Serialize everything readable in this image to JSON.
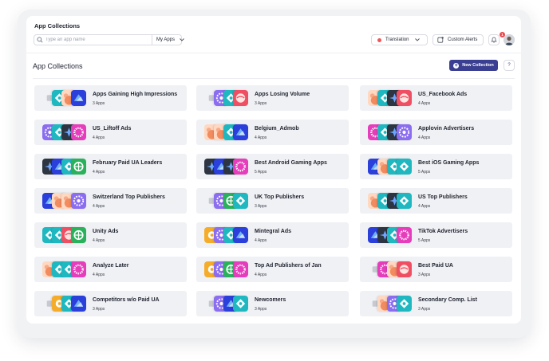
{
  "header": {
    "app_title": "App Collections",
    "search": {
      "placeholder": "Type an app name",
      "value": ""
    },
    "filter": {
      "selected": "My Apps"
    },
    "translation_label": "Translation",
    "custom_alerts_label": "Custom Alerts",
    "notification_count": "1"
  },
  "main": {
    "title": "App Collections",
    "new_collection_label": "New Collection",
    "help_label": "?"
  },
  "palette": {
    "A": [
      "#ffd8c2",
      "#f28c5f"
    ],
    "B": [
      "#2b3fdb",
      "#6fb3ff"
    ],
    "C": [
      "#20b8c0",
      "#ffffff"
    ],
    "D": [
      "#8b6df0",
      "#ffffff"
    ],
    "E": [
      "#ef4f63",
      "#ffe4e0"
    ],
    "F": [
      "#29b25b",
      "#ffffff"
    ],
    "G": [
      "#e53dbb",
      "#ffffff"
    ],
    "H": [
      "#2d3542",
      "#6fa8ff"
    ],
    "I": [
      "#f5ac2a",
      "#ffffff"
    ],
    "J": [
      "#f0f1f4",
      "#c7c9d1"
    ]
  },
  "collections": [
    {
      "name": "Apps Gaining High Impressions",
      "count": "3 Apps",
      "icons": [
        "J",
        "C",
        "A",
        "B"
      ]
    },
    {
      "name": "Apps Losing Volume",
      "count": "3 Apps",
      "icons": [
        "J",
        "D",
        "C",
        "E"
      ]
    },
    {
      "name": "US_Facebook Ads",
      "count": "4 Apps",
      "icons": [
        "A",
        "C",
        "H",
        "E"
      ]
    },
    {
      "name": "US_Liftoff Ads",
      "count": "4 Apps",
      "icons": [
        "D",
        "C",
        "H",
        "G"
      ]
    },
    {
      "name": "Belgium_Admob",
      "count": "4 Apps",
      "icons": [
        "A",
        "A",
        "C",
        "B"
      ]
    },
    {
      "name": "Applovin Advertisers",
      "count": "4 Apps",
      "icons": [
        "G",
        "C",
        "H",
        "D"
      ]
    },
    {
      "name": "February Paid UA Leaders",
      "count": "4 Apps",
      "icons": [
        "H",
        "B",
        "C",
        "F"
      ]
    },
    {
      "name": "Best Android Gaming Apps",
      "count": "5 Apps",
      "icons": [
        "H",
        "B",
        "H",
        "G"
      ]
    },
    {
      "name": "Best iOS Gaming Apps",
      "count": "5 Apps",
      "icons": [
        "B",
        "A",
        "C",
        "C"
      ]
    },
    {
      "name": "Switzerland Top Publishers",
      "count": "4 Apps",
      "icons": [
        "B",
        "A",
        "A",
        "D"
      ]
    },
    {
      "name": "UK Top Publishers",
      "count": "3 Apps",
      "icons": [
        "J",
        "D",
        "F",
        "C"
      ]
    },
    {
      "name": "US Top Publishers",
      "count": "4 Apps",
      "icons": [
        "A",
        "C",
        "H",
        "C"
      ]
    },
    {
      "name": "Unity Ads",
      "count": "4 Apps",
      "icons": [
        "C",
        "C",
        "E",
        "F"
      ]
    },
    {
      "name": "Mintegral Ads",
      "count": "4 Apps",
      "icons": [
        "I",
        "D",
        "C",
        "B"
      ]
    },
    {
      "name": "TikTok Advertisers",
      "count": "5 Apps",
      "icons": [
        "B",
        "H",
        "C",
        "G"
      ]
    },
    {
      "name": "Analyze Later",
      "count": "4 Apps",
      "icons": [
        "A",
        "C",
        "C",
        "G"
      ]
    },
    {
      "name": "Top Ad Publishers of Jan",
      "count": "4 Apps",
      "icons": [
        "I",
        "D",
        "F",
        "G"
      ]
    },
    {
      "name": "Best Paid UA",
      "count": "3 Apps",
      "icons": [
        "J",
        "G",
        "A",
        "E"
      ]
    },
    {
      "name": "Competitors w/o Paid UA",
      "count": "3 Apps",
      "icons": [
        "J",
        "I",
        "C",
        "B"
      ]
    },
    {
      "name": "Newcomers",
      "count": "3 Apps",
      "icons": [
        "J",
        "D",
        "B",
        "C"
      ]
    },
    {
      "name": "Secondary Comp. List",
      "count": "3 Apps",
      "icons": [
        "J",
        "A",
        "D",
        "C"
      ]
    }
  ]
}
